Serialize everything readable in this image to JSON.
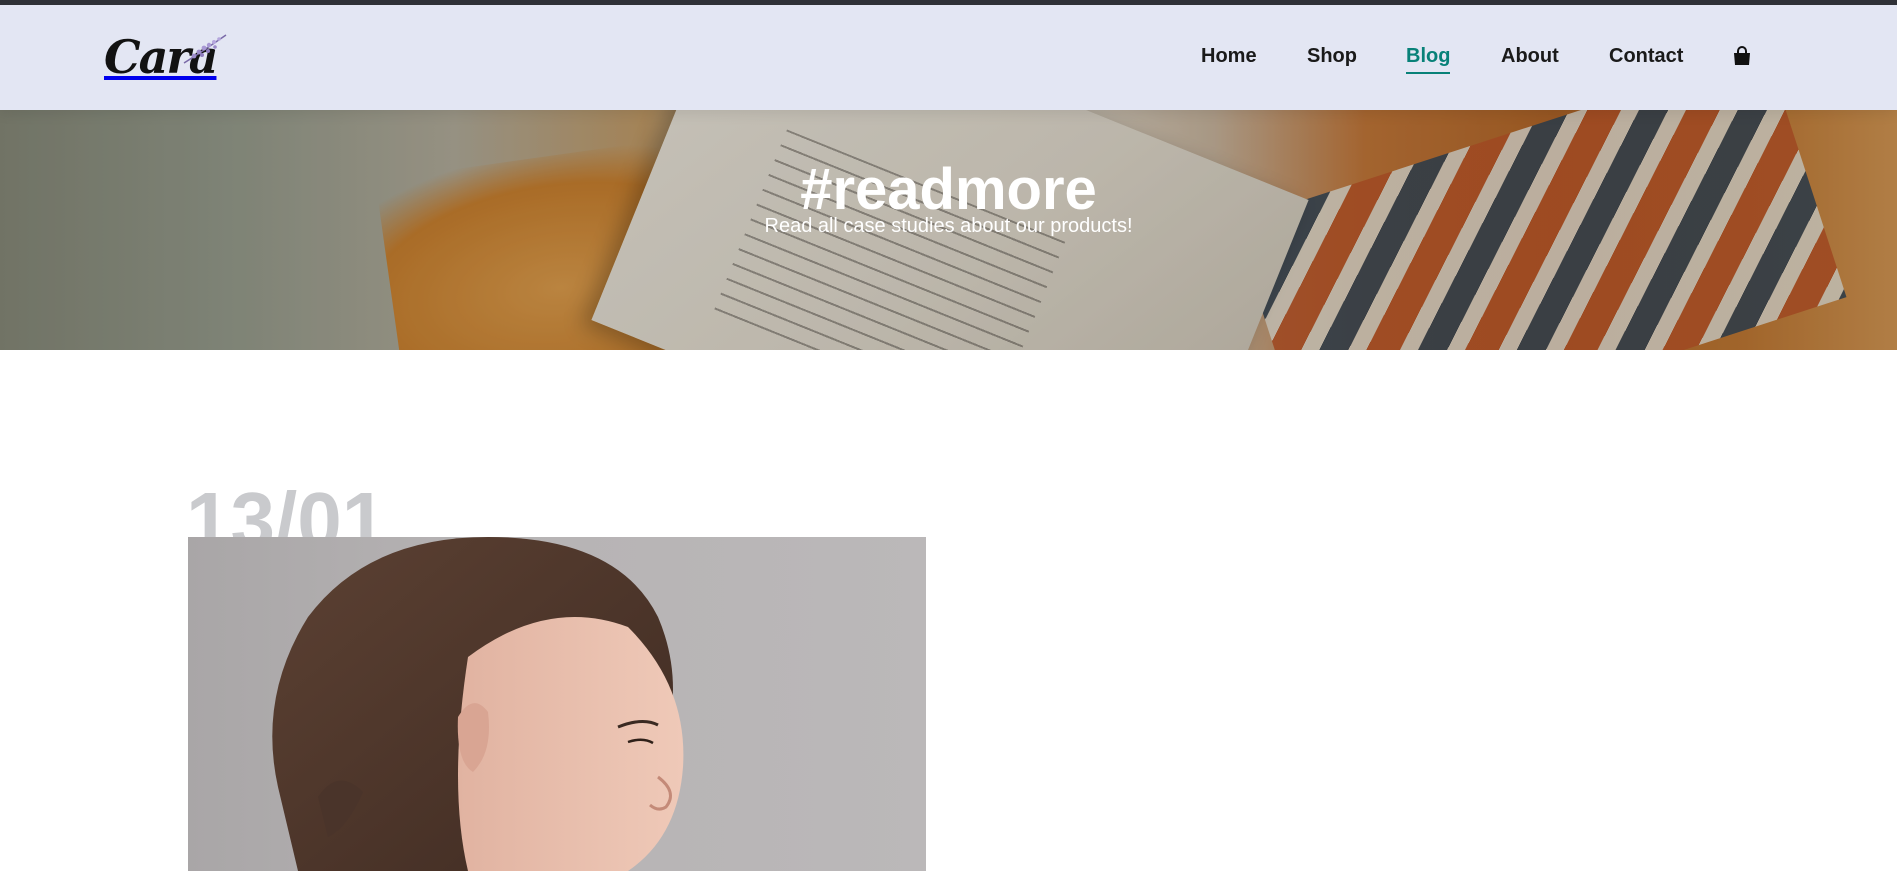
{
  "brand": {
    "logo_text": "Cara"
  },
  "nav": {
    "items": [
      {
        "label": "Home",
        "active": false
      },
      {
        "label": "Shop",
        "active": false
      },
      {
        "label": "Blog",
        "active": true
      },
      {
        "label": "About",
        "active": false
      },
      {
        "label": "Contact",
        "active": false
      }
    ],
    "cart_icon": "shopping-bag-icon"
  },
  "hero": {
    "title": "#readmore",
    "subtitle": "Read all case studies about our products!"
  },
  "blog": {
    "posts": [
      {
        "date": "13/01"
      }
    ]
  },
  "colors": {
    "header_bg": "#e3e6f3",
    "accent": "#088178",
    "nav_text": "#1a1a1a",
    "date_text": "#c9cacd"
  }
}
